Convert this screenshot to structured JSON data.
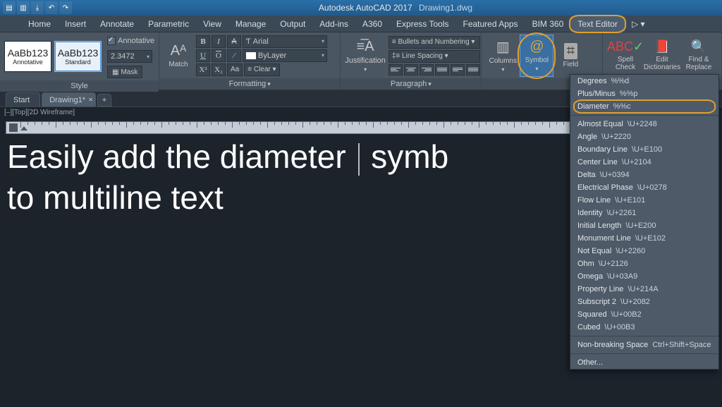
{
  "title": {
    "app": "Autodesk AutoCAD 2017",
    "file": "Drawing1.dwg"
  },
  "menus": [
    "Home",
    "Insert",
    "Annotate",
    "Parametric",
    "View",
    "Manage",
    "Output",
    "Add-ins",
    "A360",
    "Express Tools",
    "Featured Apps",
    "BIM 360",
    "Text Editor"
  ],
  "activeMenu": "Text Editor",
  "ribbon": {
    "style": {
      "title": "Style",
      "swatch1": {
        "sample": "AaBb123",
        "name": "Annotative"
      },
      "swatch2": {
        "sample": "AaBb123",
        "name": "Standard"
      },
      "annotative": "Annotative",
      "height": "2.3472",
      "mask": "Mask"
    },
    "fmt": {
      "title": "Formatting",
      "match": "Match",
      "font": "Arial",
      "layer": "ByLayer",
      "clear": "Clear",
      "btns": {
        "b": "B",
        "i": "I",
        "u": "U",
        "o": "O",
        "s": "S",
        "aa": "Aa",
        "sup": "X²",
        "sub": "X₂"
      }
    },
    "para": {
      "title": "Paragraph",
      "just": "Justification",
      "bullets": "Bullets and Numbering",
      "linesp": "Line Spacing"
    },
    "insert": {
      "columns": "Columns",
      "symbol": "Symbol",
      "field": "Field"
    },
    "tools": {
      "spell": "Spell\nCheck",
      "dict": "Edit\nDictionaries",
      "find": "Find &\nReplace"
    }
  },
  "filetabs": {
    "t1": "Start",
    "t2": "Drawing1*"
  },
  "vpLabel": "[–][Top][2D Wireframe]",
  "mtext": {
    "l1a": "Easily add the diameter ",
    "l1b": " symb",
    "l2": "to multiline text"
  },
  "dropdown": [
    {
      "label": "Degrees",
      "code": "%%d"
    },
    {
      "label": "Plus/Minus",
      "code": "%%p"
    },
    {
      "label": "Diameter",
      "code": "%%c",
      "sel": true
    },
    {
      "sep": true
    },
    {
      "label": "Almost Equal",
      "code": "\\U+2248"
    },
    {
      "label": "Angle",
      "code": "\\U+2220"
    },
    {
      "label": "Boundary Line",
      "code": "\\U+E100"
    },
    {
      "label": "Center Line",
      "code": "\\U+2104"
    },
    {
      "label": "Delta",
      "code": "\\U+0394"
    },
    {
      "label": "Electrical Phase",
      "code": "\\U+0278"
    },
    {
      "label": "Flow Line",
      "code": "\\U+E101"
    },
    {
      "label": "Identity",
      "code": "\\U+2261"
    },
    {
      "label": "Initial Length",
      "code": "\\U+E200"
    },
    {
      "label": "Monument Line",
      "code": "\\U+E102"
    },
    {
      "label": "Not Equal",
      "code": "\\U+2260"
    },
    {
      "label": "Ohm",
      "code": "\\U+2126"
    },
    {
      "label": "Omega",
      "code": "\\U+03A9"
    },
    {
      "label": "Property Line",
      "code": "\\U+214A"
    },
    {
      "label": "Subscript 2",
      "code": "\\U+2082"
    },
    {
      "label": "Squared",
      "code": "\\U+00B2"
    },
    {
      "label": "Cubed",
      "code": "\\U+00B3"
    },
    {
      "sep": true
    },
    {
      "label": "Non-breaking Space",
      "code": "Ctrl+Shift+Space"
    },
    {
      "sep": true
    },
    {
      "label": "Other..."
    }
  ]
}
